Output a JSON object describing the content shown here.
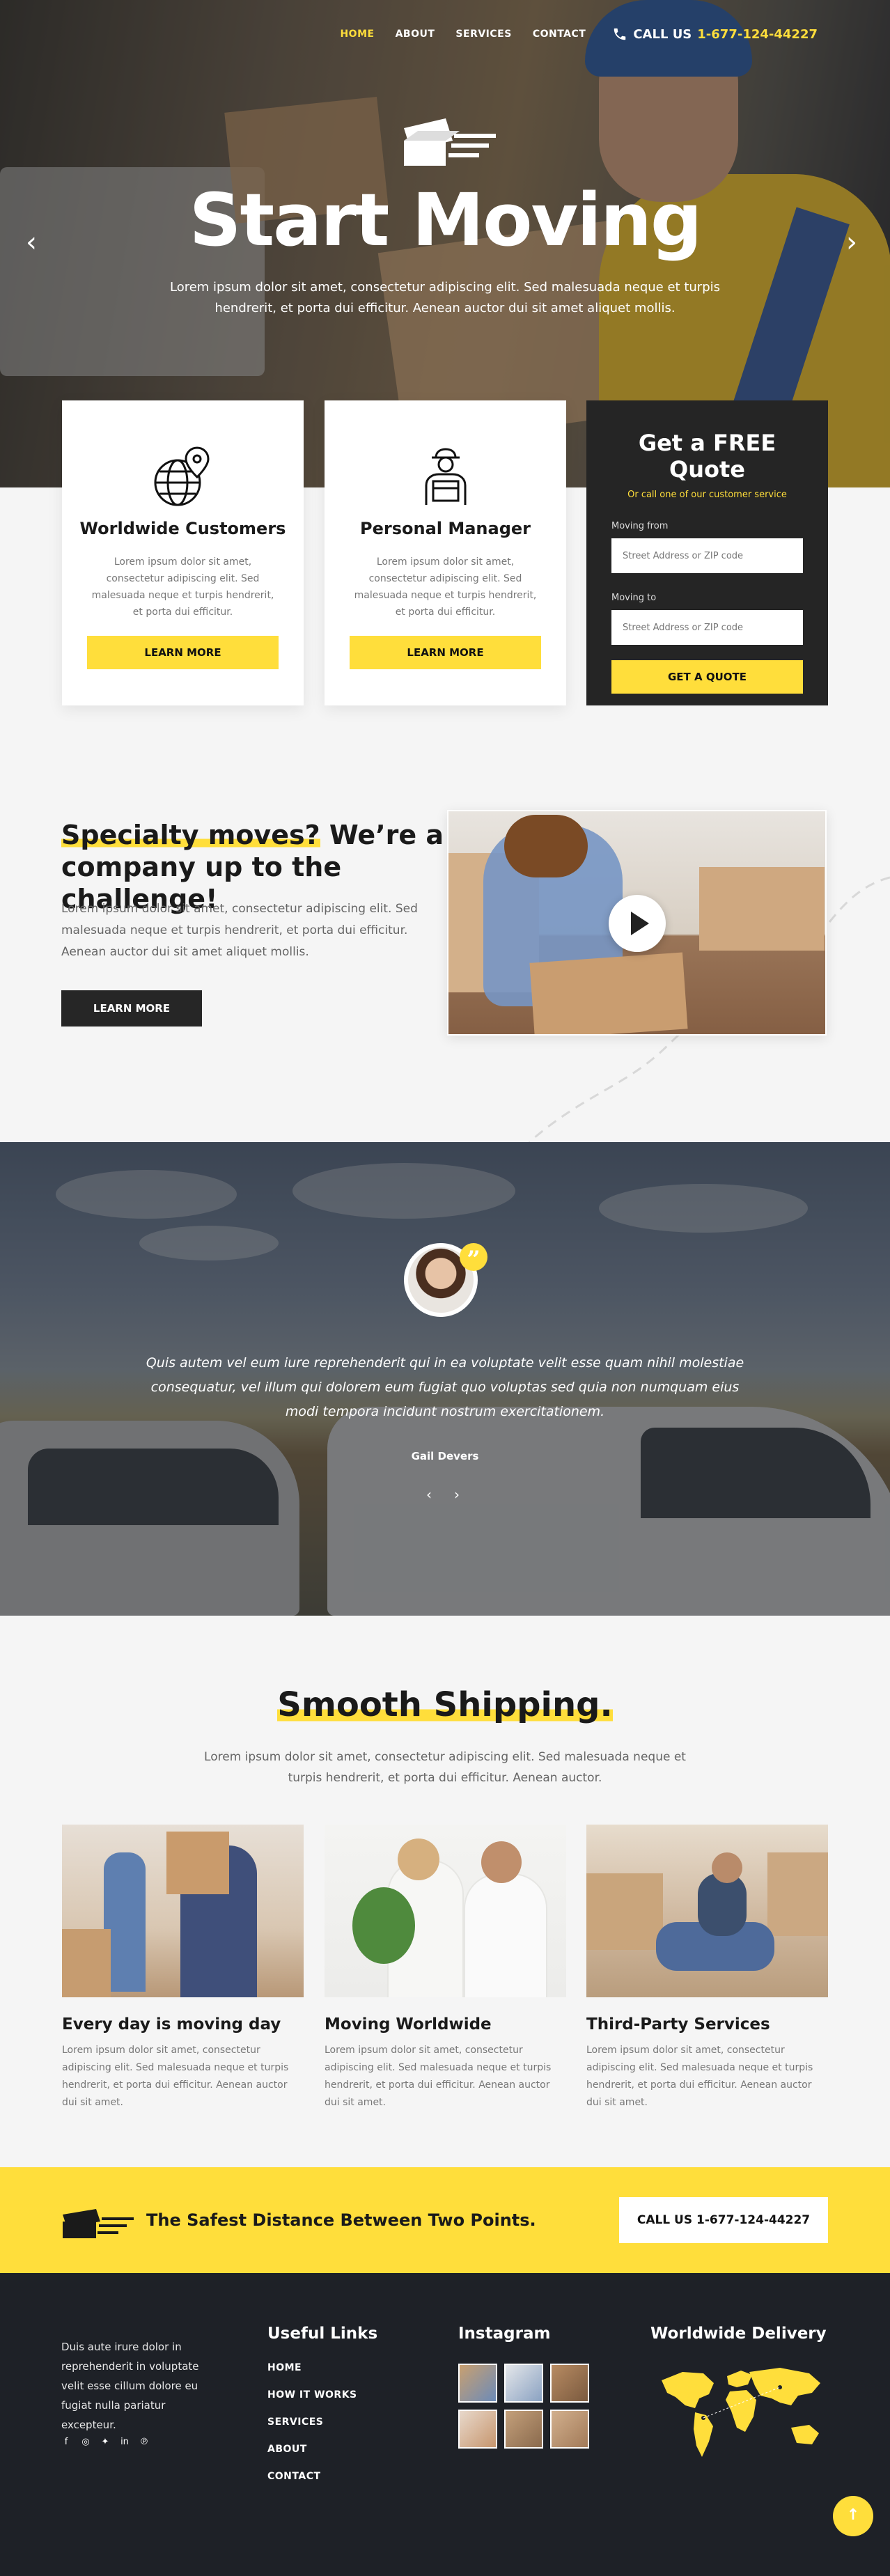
{
  "nav": {
    "items": [
      "HOME",
      "ABOUT",
      "SERVICES",
      "CONTACT"
    ],
    "call_label": "CALL US",
    "call_number": "1-677-124-44227"
  },
  "hero": {
    "title": "Start Moving",
    "text": "Lorem ipsum dolor sit amet, consectetur adipiscing elit. Sed malesuada neque et turpis hendrerit, et porta dui efficitur. Aenean auctor dui sit amet aliquet mollis."
  },
  "cards": [
    {
      "icon": "globe-pin-icon",
      "title": "Worldwide Customers",
      "text": "Lorem ipsum dolor sit amet, consectetur adipiscing elit. Sed malesuada neque et turpis hendrerit, et porta dui efficitur.",
      "button": "LEARN MORE"
    },
    {
      "icon": "delivery-person-icon",
      "title": "Personal Manager",
      "text": "Lorem ipsum dolor sit amet, consectetur adipiscing elit. Sed malesuada neque et turpis hendrerit, et porta dui efficitur.",
      "button": "LEARN MORE"
    }
  ],
  "quote": {
    "title": "Get a FREE Quote",
    "subtitle": "Or call one of our customer service",
    "from_label": "Moving from",
    "from_placeholder": "Street Address or ZIP code",
    "to_label": "Moving to",
    "to_placeholder": "Street Address or ZIP code",
    "button": "GET A QUOTE"
  },
  "specialty": {
    "title_highlight": "Specialty moves?",
    "title_rest": " We’re a company up to the challenge!",
    "text": "Lorem ipsum dolor sit amet, consectetur adipiscing elit. Sed malesuada neque et turpis hendrerit, et porta dui efficitur. Aenean auctor dui sit amet aliquet mollis.",
    "button": "LEARN MORE"
  },
  "testimonial": {
    "quote_mark": "”",
    "text": "Quis autem vel eum iure reprehenderit qui in ea voluptate velit esse quam nihil molestiae consequatur, vel illum qui dolorem eum fugiat quo voluptas sed quia non numquam eius modi tempora incidunt nostrum exercitationem.",
    "name": "Gail Devers",
    "prev": "‹",
    "next": "›"
  },
  "shipping": {
    "title": "Smooth Shipping.",
    "text": "Lorem ipsum dolor sit amet, consectetur adipiscing elit. Sed malesuada neque et turpis hendrerit, et porta dui efficitur. Aenean auctor.",
    "services": [
      {
        "title": "Every day is moving day",
        "text": "Lorem ipsum dolor sit amet, consectetur adipiscing elit. Sed malesuada neque et turpis hendrerit, et porta dui efficitur. Aenean auctor dui sit amet."
      },
      {
        "title": "Moving Worldwide",
        "text": "Lorem ipsum dolor sit amet, consectetur adipiscing elit. Sed malesuada neque et turpis hendrerit, et porta dui efficitur. Aenean auctor dui sit amet."
      },
      {
        "title": "Third-Party Services",
        "text": "Lorem ipsum dolor sit amet, consectetur adipiscing elit. Sed malesuada neque et turpis hendrerit, et porta dui efficitur. Aenean auctor dui sit amet."
      }
    ]
  },
  "cta": {
    "text": "The Safest Distance Between Two Points.",
    "button": "CALL US 1-677-124-44227"
  },
  "footer": {
    "about": "Duis aute irure dolor in reprehenderit in voluptate velit esse cillum dolore eu fugiat nulla pariatur excepteur.",
    "social": [
      "facebook-icon",
      "instagram-icon",
      "twitter-icon",
      "linkedin-icon",
      "pinterest-icon"
    ],
    "useful_links_title": "Useful Links",
    "links": [
      "HOME",
      "HOW IT WORKS",
      "SERVICES",
      "ABOUT",
      "CONTACT"
    ],
    "instagram_title": "Instagram",
    "delivery_title": "Worldwide Delivery"
  },
  "colors": {
    "accent": "#ffde3b",
    "dark": "#252525",
    "footer": "#1e2127"
  }
}
